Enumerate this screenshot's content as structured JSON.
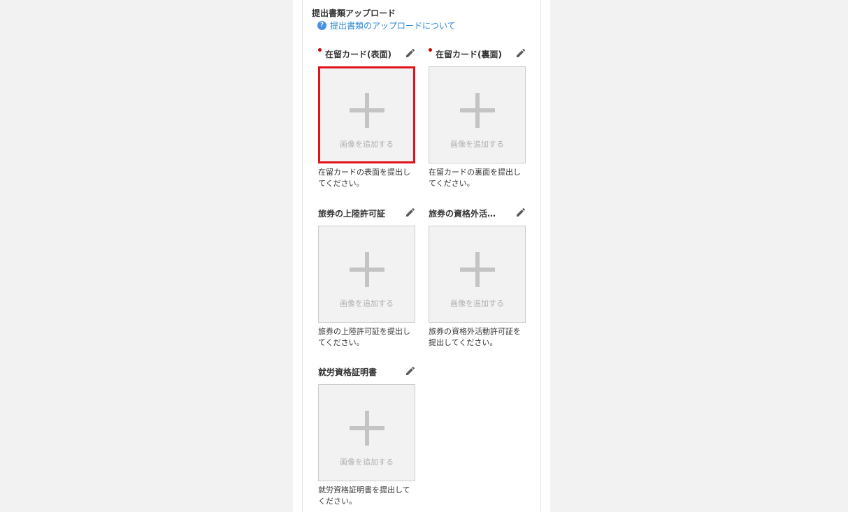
{
  "section": {
    "title": "提出書類アップロード",
    "help_link": "提出書類のアップロードについて",
    "help_icon_glyph": "?"
  },
  "upload_placeholder": "画像を追加する",
  "slots": [
    {
      "label": "在留カード(表面)",
      "required": true,
      "selected": true,
      "description": "在留カードの表面を提出してください。"
    },
    {
      "label": "在留カード(裏面)",
      "required": true,
      "selected": false,
      "description": "在留カードの裏面を提出してください。"
    },
    {
      "label": "旅券の上陸許可証",
      "required": false,
      "selected": false,
      "description": "旅券の上陸許可証を提出してください。"
    },
    {
      "label": "旅券の資格外活…",
      "required": false,
      "selected": false,
      "description": "旅券の資格外活動許可証を提出してください。"
    },
    {
      "label": "就労資格証明書",
      "required": false,
      "selected": false,
      "description": "就労資格証明書を提出してください。"
    }
  ],
  "colors": {
    "required_marker": "#d40000",
    "selected_border": "#e0121b",
    "link": "#2f8ad8"
  },
  "icons": {
    "edit": "pencil-icon",
    "add": "plus-icon",
    "help": "question-circle-icon"
  }
}
